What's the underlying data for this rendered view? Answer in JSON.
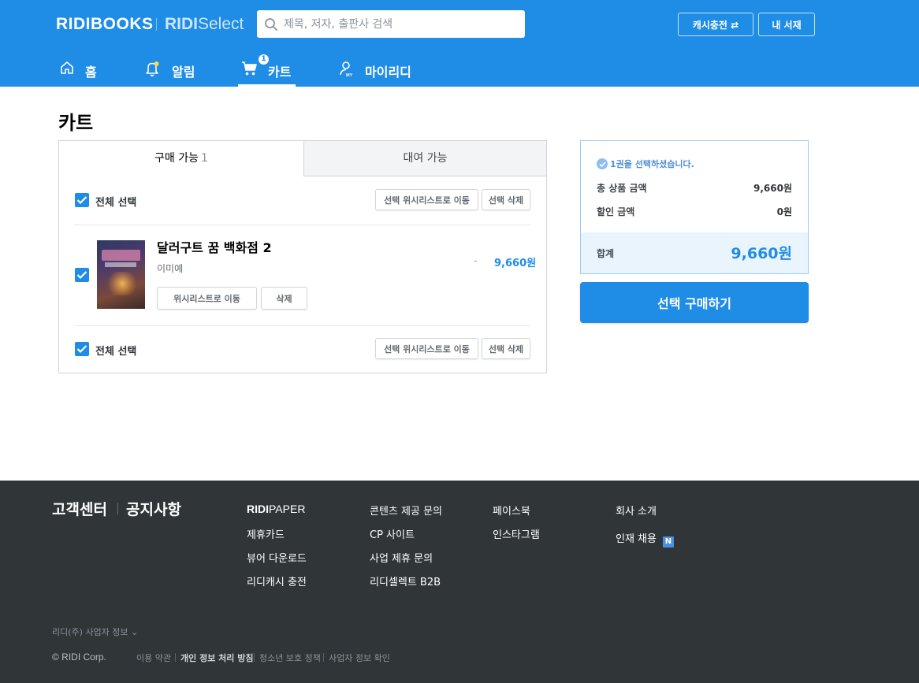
{
  "header": {
    "logo": "RIDIBOOKS",
    "select_logo_bold": "RIDI",
    "select_logo_light": "Select",
    "search_placeholder": "제목, 저자, 출판사 검색",
    "cash_button": "캐시충전",
    "library_button": "내 서재"
  },
  "nav": {
    "home": "홈",
    "alarm": "알림",
    "cart": "카트",
    "cart_count": "1",
    "my": "마이리디"
  },
  "page": {
    "title": "카트"
  },
  "tabs": {
    "buy_label": "구매 가능",
    "buy_count": "1",
    "rent_label": "대여 가능"
  },
  "cart_actions": {
    "select_all": "전체 선택",
    "move_wishlist_selected": "선택 위시리스트로 이동",
    "delete_selected": "선택 삭제"
  },
  "items": [
    {
      "title": "달러구트 꿈 백화점 2",
      "author": "이미예",
      "list_price": "-",
      "price": "9,660원",
      "move_wishlist": "위시리스트로 이동",
      "delete": "삭제"
    }
  ],
  "summary": {
    "message": "1권을 선택하셨습니다.",
    "total_price_label": "총 상품 금액",
    "total_price": "9,660원",
    "discount_label": "할인 금액",
    "discount": "0원",
    "sum_label": "합계",
    "sum": "9,660원",
    "buy_button": "선택 구매하기"
  },
  "footer": {
    "customer_center": "고객센터",
    "notice": "공지사항",
    "col1": {
      "paper_bold": "RIDI",
      "paper_light": "PAPER",
      "items": [
        "제휴카드",
        "뷰어 다운로드",
        "리디캐시 충전"
      ]
    },
    "col2": [
      "콘텐츠 제공 문의",
      "CP 사이트",
      "사업 제휴 문의",
      "리디셀렉트 B2B"
    ],
    "col3": [
      "페이스북",
      "인스타그램"
    ],
    "col4": [
      "회사 소개",
      "인재 채용"
    ],
    "col4_badge": "N",
    "business_info": "리디(주) 사업자 정보 ⌄",
    "copyright": "© RIDI Corp.",
    "legal": [
      "이용 약관",
      "개인 정보 처리 방침",
      "청소년 보호 정책",
      "사업자 정보 확인"
    ]
  },
  "colors": {
    "brand": "#1f8ce6",
    "footer_bg": "#303538"
  }
}
